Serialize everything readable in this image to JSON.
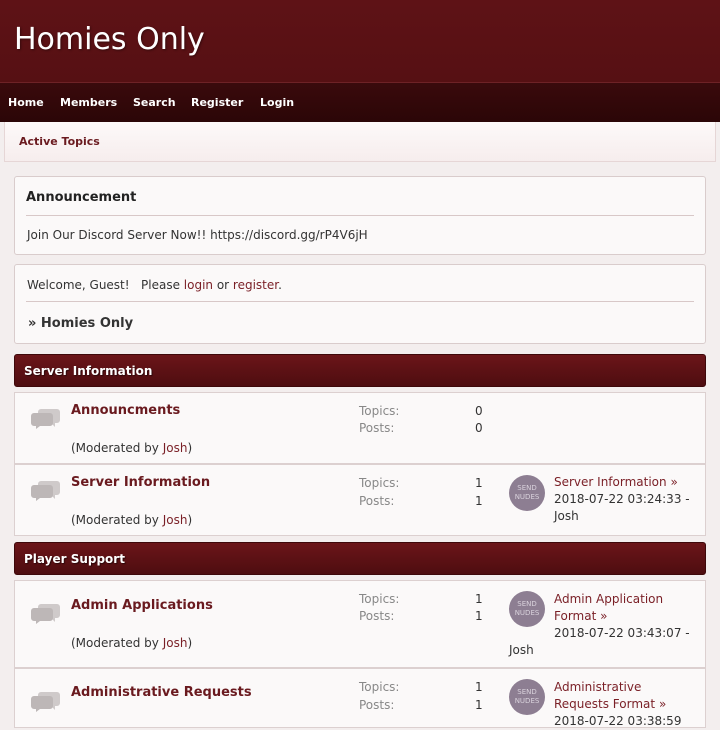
{
  "site": {
    "title": "Homies Only"
  },
  "nav": {
    "home": "Home",
    "members": "Members",
    "search": "Search",
    "register": "Register",
    "login": "Login"
  },
  "active_topics": "Active Topics",
  "announcement": {
    "title": "Announcement",
    "text": "Join Our Discord Server Now!! https://discord.gg/rP4V6jH"
  },
  "welcome": {
    "prefix": "Welcome, Guest!   Please ",
    "login": "login",
    "or": " or ",
    "register": "register",
    "suffix": "."
  },
  "breadcrumb": "» Homies Only",
  "labels": {
    "topics": "Topics:",
    "posts": "Posts:",
    "moderated_prefix": "(Moderated by ",
    "moderated_suffix": ")",
    "arrow": "»"
  },
  "avatar_text": "SEND NUDES",
  "categories": [
    {
      "title": "Server Information",
      "forums": [
        {
          "name": "Announcments",
          "moderator": "Josh",
          "topics": "0",
          "posts": "0"
        },
        {
          "name": "Server Information",
          "moderator": "Josh",
          "topics": "1",
          "posts": "1",
          "last_post_title": "Server Information",
          "last_post_date": "2018-07-22 03:24:33 -",
          "last_post_user": "Josh"
        }
      ]
    },
    {
      "title": "Player Support",
      "forums": [
        {
          "name": "Admin Applications",
          "moderator": "Josh",
          "topics": "1",
          "posts": "1",
          "last_post_title_1": "Admin Application",
          "last_post_title_2": "Format",
          "last_post_date": "2018-07-22 03:43:07 -",
          "last_post_user": "Josh"
        },
        {
          "name": "Administrative Requests",
          "topics": "1",
          "posts": "1",
          "last_post_title_1": "Administrative",
          "last_post_title_2": "Requests Format",
          "last_post_date": "2018-07-22 03:38:59"
        }
      ]
    }
  ],
  "colors": {
    "header": "#5e1216",
    "navbar": "#330809",
    "link": "#7a1f26",
    "category": "#5c1115"
  }
}
